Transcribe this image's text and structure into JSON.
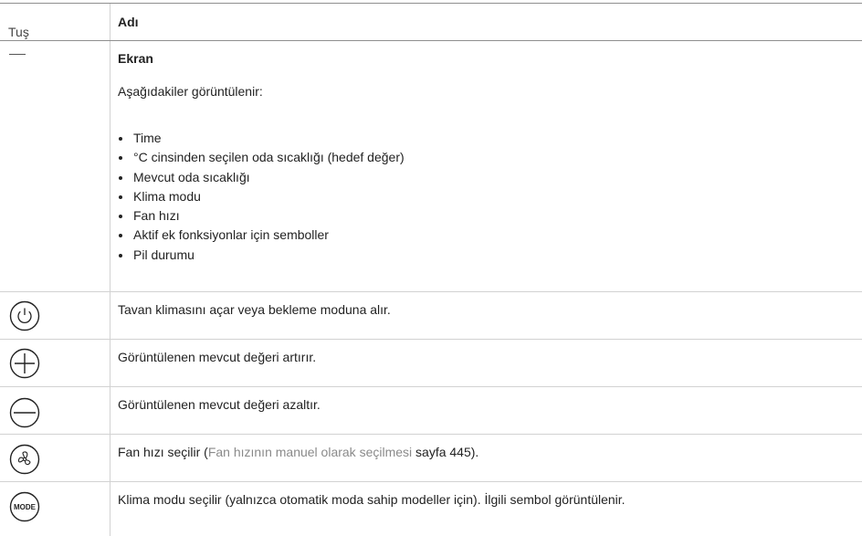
{
  "table": {
    "header": {
      "key_label": "Tuş",
      "name_label": "Adı"
    },
    "display_row": {
      "key_symbol": "—",
      "title": "Ekran",
      "intro": "Aşağıdakiler görüntülenir:",
      "items": [
        "Time",
        "°C cinsinden seçilen oda sıcaklığı (hedef değer)",
        "Mevcut oda sıcaklığı",
        "Klima modu",
        "Fan hızı",
        "Aktif ek fonksiyonlar için semboller",
        "Pil durumu"
      ]
    },
    "rows": [
      {
        "icon": "power-icon",
        "description": "Tavan klimasını açar veya bekleme moduna alır."
      },
      {
        "icon": "plus-icon",
        "description": "Görüntülenen mevcut değeri artırır."
      },
      {
        "icon": "minus-icon",
        "description": "Görüntülenen mevcut değeri azaltır."
      },
      {
        "icon": "fan-icon",
        "description_prefix": "Fan hızı seçilir (",
        "link_text": "Fan hızının manuel olarak seçilmesi",
        "description_suffix": " sayfa 445)."
      },
      {
        "icon": "mode-icon",
        "icon_text": "MODE",
        "description": "Klima modu seçilir (yalnızca otomatik moda sahip modeller için). İlgili sembol görüntülenir."
      }
    ]
  },
  "colors": {
    "text": "#222222",
    "border": "#d2d2d2",
    "link": "#8a8a8a"
  }
}
